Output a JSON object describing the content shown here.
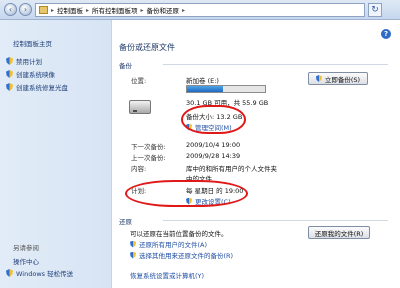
{
  "address": {
    "segments": [
      "控制面板",
      "所有控制面板项",
      "备份和还原"
    ]
  },
  "sidebar": {
    "home": "控制面板主页",
    "items": [
      {
        "label": "禁用计划"
      },
      {
        "label": "创建系统映像"
      },
      {
        "label": "创建系统修复光盘"
      }
    ],
    "see_also": "另请参阅",
    "links": [
      "操作中心",
      "Windows 轻松传送"
    ]
  },
  "main": {
    "title": "备份或还原文件",
    "backup_section": "备份",
    "location_label": "位置:",
    "location_value": "新加卷 (E:)",
    "disk_usage": "30.1 GB 可用，共 55.9 GB",
    "disk_used_fraction": 0.46,
    "backup_size": "备份大小: 13.2 GB",
    "manage_space": "管理空间(M)",
    "next_backup_label": "下一次备份:",
    "next_backup_value": "2009/10/4 19:00",
    "last_backup_label": "上一次备份:",
    "last_backup_value": "2009/9/28 14:39",
    "contents_label": "内容:",
    "contents_line1": "库中的和所有用户的个人文件夹",
    "contents_line2": "中的文件",
    "schedule_label": "计划:",
    "schedule_value": "每 星期日 的 19:00",
    "change_settings": "更改设置(C)",
    "backup_now": "立即备份(S)",
    "restore_section": "还原",
    "restore_text": "可以还原在当前位置备份的文件。",
    "restore_all_users": "还原所有用户的文件(A)",
    "select_other_backup": "选择其他用来还原文件的备份(R)",
    "recover_system": "恢复系统设置或计算机(Y)",
    "restore_my_files": "还原我的文件(R)"
  }
}
